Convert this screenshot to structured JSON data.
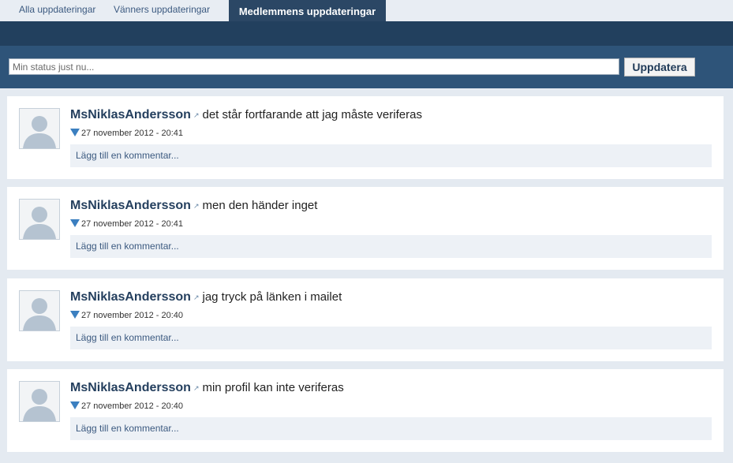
{
  "tabs": [
    {
      "label": "Alla uppdateringar"
    },
    {
      "label": "Vänners uppdateringar"
    },
    {
      "label": "Medlemmens uppdateringar"
    }
  ],
  "status": {
    "placeholder": "Min status just nu...",
    "button_label": "Uppdatera"
  },
  "posts": [
    {
      "author": "MsNiklasAndersson",
      "text": "det står fortfarande att jag måste veriferas",
      "timestamp": "27 november 2012 - 20:41",
      "comment_placeholder": "Lägg till en kommentar..."
    },
    {
      "author": "MsNiklasAndersson",
      "text": "men den händer inget",
      "timestamp": "27 november 2012 - 20:41",
      "comment_placeholder": "Lägg till en kommentar..."
    },
    {
      "author": "MsNiklasAndersson",
      "text": "jag tryck på länken i mailet",
      "timestamp": "27 november 2012 - 20:40",
      "comment_placeholder": "Lägg till en kommentar..."
    },
    {
      "author": "MsNiklasAndersson",
      "text": "min profil kan inte veriferas",
      "timestamp": "27 november 2012 - 20:40",
      "comment_placeholder": "Lägg till en kommentar..."
    }
  ],
  "colors": {
    "active_tab": "#2b4765",
    "header_bar": "#22405e",
    "status_bar": "#2e5479",
    "author": "#243f5e"
  },
  "icons": [
    "external-link-icon",
    "avatar-placeholder-icon",
    "blue-triangle-icon"
  ]
}
